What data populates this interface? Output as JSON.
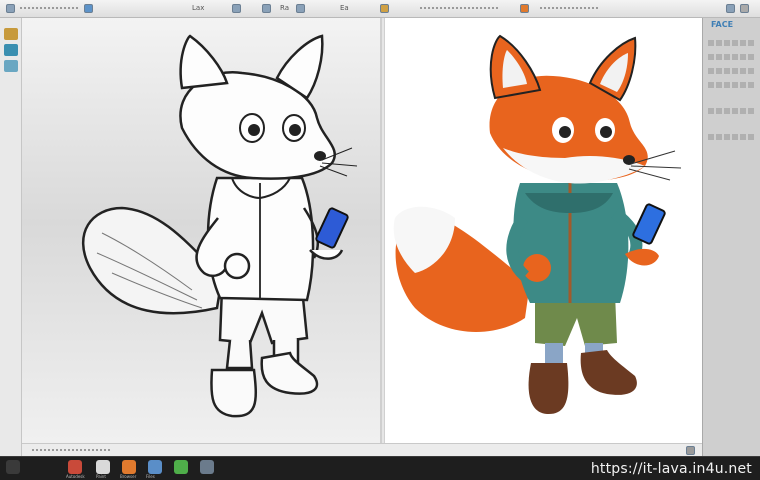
{
  "toolbar": {
    "items": [
      "Lax",
      "Ra",
      "Ea"
    ],
    "icons": [
      "app-menu-icon",
      "file-icon",
      "edit-icon",
      "view-icon",
      "layers-icon",
      "brush-icon",
      "help-icon"
    ]
  },
  "right_panel": {
    "title": "FACE"
  },
  "taskbar": {
    "labels": [
      "Autodesk",
      "Paint",
      "Browser",
      "Files"
    ]
  },
  "watermark": "https://it-lava.in4u.net",
  "colors": {
    "fox_orange": "#e8641e",
    "jacket_teal": "#3d8a86",
    "shorts_green": "#6f8a4b",
    "boots_brown": "#6b3a22",
    "phone_blue": "#2d6fe0"
  }
}
